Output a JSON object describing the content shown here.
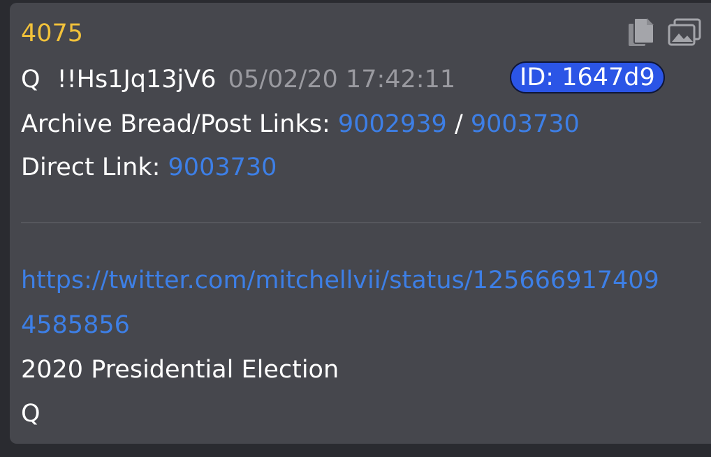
{
  "post": {
    "number": "4075",
    "poster": "Q",
    "tripcode": "!!Hs1Jq13jV6",
    "timestamp": "05/02/20 17:42:11",
    "id_badge": "ID: 1647d9",
    "archive_label": "Archive Bread/Post Links:",
    "archive_link_1": "9002939",
    "archive_separator": "/",
    "archive_link_2": "9003730",
    "direct_label": "Direct Link:",
    "direct_link": "9003730",
    "url_part_1": "https://twitter.com/mitchellvii/status/125666917409",
    "url_part_2": "4585856",
    "body_line_1": "2020 Presidential Election",
    "body_line_2": "Q"
  },
  "icons": {
    "copy": "copy-icon",
    "images": "images-icon"
  },
  "colors": {
    "card_bg": "#46474d",
    "post_number": "#f2c23a",
    "link": "#3d7fe6",
    "id_badge_bg": "#2b55e6",
    "timestamp": "#9a9aa0"
  }
}
